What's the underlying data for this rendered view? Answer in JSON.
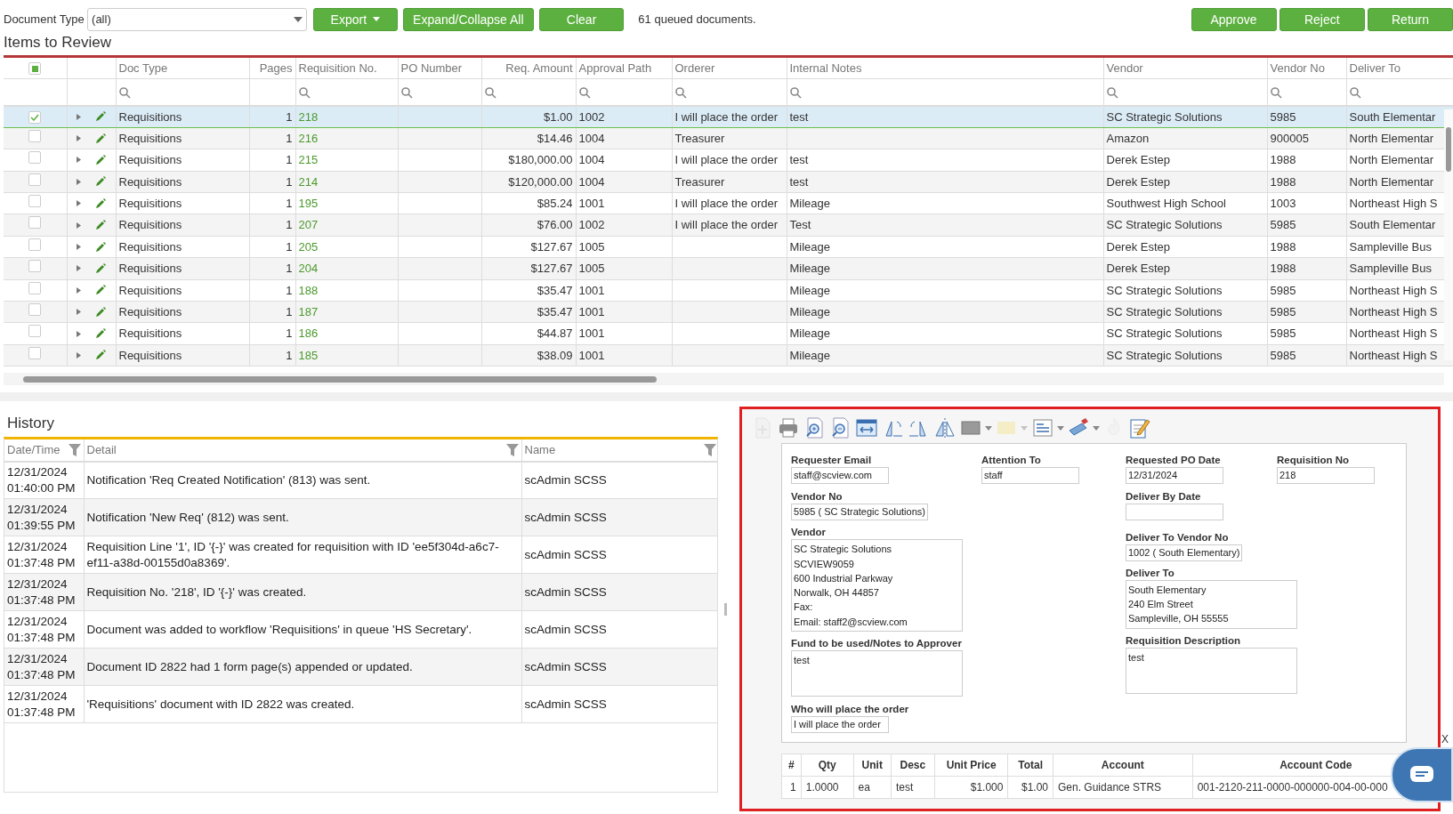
{
  "toolbar": {
    "document_type_label": "Document Type",
    "document_type_value": "(all)",
    "buttons": [
      {
        "label": "Export",
        "menu": true
      },
      {
        "label": "Expand/Collapse All",
        "menu": false
      },
      {
        "label": "Clear",
        "menu": false
      }
    ],
    "queue_count": "61 queued documents.",
    "action_buttons": [
      "Approve",
      "Reject",
      "Return"
    ]
  },
  "items_title": "Items to Review",
  "grid": {
    "select_all_indeterminate": true,
    "columns": [
      {
        "label": "Doc Type",
        "kind": "text",
        "filter": true
      },
      {
        "label": "Pages",
        "kind": "number",
        "filter": false
      },
      {
        "label": "Requisition No.",
        "kind": "link",
        "filter": true
      },
      {
        "label": "PO Number",
        "kind": "text",
        "filter": true
      },
      {
        "label": "Req. Amount",
        "kind": "number",
        "filter": true
      },
      {
        "label": "Approval Path",
        "kind": "text",
        "filter": true
      },
      {
        "label": "Orderer",
        "kind": "text",
        "filter": true
      },
      {
        "label": "Internal Notes",
        "kind": "text",
        "filter": true
      },
      {
        "label": "Vendor",
        "kind": "text",
        "filter": true
      },
      {
        "label": "Vendor No",
        "kind": "text",
        "filter": true
      },
      {
        "label": "Deliver To",
        "kind": "text",
        "filter": true
      }
    ],
    "rows": [
      {
        "selected": true,
        "doc_type": "Requisitions",
        "pages": "1",
        "requisition_no": "218",
        "req_amount": "$1.00",
        "approval_path": "1002",
        "orderer": "I will place the order",
        "internal_notes": "test",
        "vendor": "SC Strategic Solutions",
        "vendor_no": "5985",
        "deliver_to": "South Elementar"
      },
      {
        "selected": false,
        "doc_type": "Requisitions",
        "pages": "1",
        "requisition_no": "216",
        "req_amount": "$14.46",
        "approval_path": "1004",
        "orderer": "Treasurer",
        "vendor": "Amazon",
        "vendor_no": "900005",
        "deliver_to": "North Elementar"
      },
      {
        "selected": false,
        "doc_type": "Requisitions",
        "pages": "1",
        "requisition_no": "215",
        "req_amount": "$180,000.00",
        "approval_path": "1004",
        "orderer": "I will place the order",
        "internal_notes": "test",
        "vendor": "Derek Estep",
        "vendor_no": "1988",
        "deliver_to": "North Elementar"
      },
      {
        "selected": false,
        "doc_type": "Requisitions",
        "pages": "1",
        "requisition_no": "214",
        "req_amount": "$120,000.00",
        "approval_path": "1004",
        "orderer": "Treasurer",
        "internal_notes": "test",
        "vendor": "Derek Estep",
        "vendor_no": "1988",
        "deliver_to": "North Elementar"
      },
      {
        "selected": false,
        "doc_type": "Requisitions",
        "pages": "1",
        "requisition_no": "195",
        "req_amount": "$85.24",
        "approval_path": "1001",
        "orderer": "I will place the order",
        "internal_notes": "Mileage",
        "vendor": "Southwest High School",
        "vendor_no": "1003",
        "deliver_to": "Northeast High S"
      },
      {
        "selected": false,
        "doc_type": "Requisitions",
        "pages": "1",
        "requisition_no": "207",
        "req_amount": "$76.00",
        "approval_path": "1002",
        "orderer": "I will place the order",
        "internal_notes": "Test",
        "vendor": "SC Strategic Solutions",
        "vendor_no": "5985",
        "deliver_to": "South Elementar"
      },
      {
        "selected": false,
        "doc_type": "Requisitions",
        "pages": "1",
        "requisition_no": "205",
        "req_amount": "$127.67",
        "approval_path": "1005",
        "internal_notes": "Mileage",
        "vendor": "Derek Estep",
        "vendor_no": "1988",
        "deliver_to": "Sampleville Bus"
      },
      {
        "selected": false,
        "doc_type": "Requisitions",
        "pages": "1",
        "requisition_no": "204",
        "req_amount": "$127.67",
        "approval_path": "1005",
        "internal_notes": "Mileage",
        "vendor": "Derek Estep",
        "vendor_no": "1988",
        "deliver_to": "Sampleville Bus"
      },
      {
        "selected": false,
        "doc_type": "Requisitions",
        "pages": "1",
        "requisition_no": "188",
        "req_amount": "$35.47",
        "approval_path": "1001",
        "internal_notes": "Mileage",
        "vendor": "SC Strategic Solutions",
        "vendor_no": "5985",
        "deliver_to": "Northeast High S"
      },
      {
        "selected": false,
        "doc_type": "Requisitions",
        "pages": "1",
        "requisition_no": "187",
        "req_amount": "$35.47",
        "approval_path": "1001",
        "internal_notes": "Mileage",
        "vendor": "SC Strategic Solutions",
        "vendor_no": "5985",
        "deliver_to": "Northeast High S"
      },
      {
        "selected": false,
        "doc_type": "Requisitions",
        "pages": "1",
        "requisition_no": "186",
        "req_amount": "$44.87",
        "approval_path": "1001",
        "internal_notes": "Mileage",
        "vendor": "SC Strategic Solutions",
        "vendor_no": "5985",
        "deliver_to": "Northeast High S"
      },
      {
        "selected": false,
        "doc_type": "Requisitions",
        "pages": "1",
        "requisition_no": "185",
        "req_amount": "$38.09",
        "approval_path": "1001",
        "internal_notes": "Mileage",
        "vendor": "SC Strategic Solutions",
        "vendor_no": "5985",
        "deliver_to": "Northeast High S"
      }
    ]
  },
  "history": {
    "title": "History",
    "columns": [
      {
        "label": "Date/Time",
        "filter": true
      },
      {
        "label": "Detail",
        "filter": true
      },
      {
        "label": "Name",
        "filter": true
      }
    ],
    "rows": [
      {
        "date": "12/31/2024",
        "time": "01:40:00 PM",
        "detail": "Notification 'Req Created Notification' (813) was sent.",
        "name": "scAdmin SCSS"
      },
      {
        "date": "12/31/2024",
        "time": "01:39:55 PM",
        "detail": "Notification 'New Req' (812) was sent.",
        "name": "scAdmin SCSS"
      },
      {
        "date": "12/31/2024",
        "time": "01:37:48 PM",
        "detail": "Requisition Line '1', ID '{-}' was created for requisition with ID 'ee5f304d-a6c7-ef11-a38d-00155d0a8369'.",
        "name": "scAdmin SCSS"
      },
      {
        "date": "12/31/2024",
        "time": "01:37:48 PM",
        "detail": "Requisition No. '218', ID '{-}' was created.",
        "name": "scAdmin SCSS"
      },
      {
        "date": "12/31/2024",
        "time": "01:37:48 PM",
        "detail": "Document was added to workflow 'Requisitions' in queue 'HS Secretary'.",
        "name": "scAdmin SCSS"
      },
      {
        "date": "12/31/2024",
        "time": "01:37:48 PM",
        "detail": "Document ID 2822 had 1 form page(s) appended or updated.",
        "name": "scAdmin SCSS"
      },
      {
        "date": "12/31/2024",
        "time": "01:37:48 PM",
        "detail": "'Requisitions' document with ID 2822 was created.",
        "name": "scAdmin SCSS"
      }
    ]
  },
  "document": {
    "tools": [
      {
        "kind": "add-page",
        "disabled": true,
        "menu": false
      },
      {
        "kind": "print",
        "disabled": false,
        "menu": false
      },
      {
        "kind": "zoom-in",
        "disabled": false,
        "menu": false
      },
      {
        "kind": "zoom-out",
        "disabled": false,
        "menu": false
      },
      {
        "kind": "fit-width",
        "disabled": false,
        "menu": false
      },
      {
        "kind": "rotate-left",
        "disabled": false,
        "menu": false
      },
      {
        "kind": "rotate-right",
        "disabled": false,
        "menu": false
      },
      {
        "kind": "flip",
        "disabled": false,
        "menu": false
      },
      {
        "kind": "rectangle",
        "disabled": false,
        "menu": true
      },
      {
        "kind": "highlight",
        "disabled": true,
        "menu": true
      },
      {
        "kind": "text-box",
        "disabled": false,
        "menu": true
      },
      {
        "kind": "stamp",
        "disabled": false,
        "menu": true
      },
      {
        "kind": "flame",
        "disabled": true,
        "menu": false
      },
      {
        "kind": "note",
        "disabled": false,
        "menu": false
      }
    ],
    "top_fields": [
      {
        "label": "Requester Email",
        "kind": "input",
        "value": "staff@scview.com"
      },
      {
        "label": "Attention To",
        "kind": "input",
        "value": "staff"
      },
      {
        "label": "Requested PO Date",
        "kind": "input",
        "value": "12/31/2024"
      },
      {
        "label": "Requisition No",
        "kind": "input",
        "value": "218"
      }
    ],
    "left_fields": [
      {
        "label": "Vendor No",
        "kind": "input",
        "value": "5985 ( SC Strategic Solutions)"
      },
      {
        "label": "Vendor",
        "kind": "textarea",
        "lines": [
          "SC Strategic Solutions",
          "SCVIEW9059",
          "600 Industrial Parkway",
          "Norwalk, OH 44857",
          "Fax:",
          "Email: staff2@scview.com"
        ]
      },
      {
        "label": "Fund to be used/Notes to Approver",
        "kind": "textarea",
        "lines": [
          "test"
        ]
      },
      {
        "label": "Who will place the order",
        "kind": "input",
        "value": "I will place the order"
      }
    ],
    "right_fields": [
      {
        "label": "Deliver By Date",
        "kind": "input"
      },
      {
        "label": "Deliver To Vendor No",
        "kind": "input",
        "value": "1002 ( South Elementary)"
      },
      {
        "label": "Deliver To",
        "kind": "textarea",
        "lines": [
          "South Elementary",
          "240 Elm Street",
          "Sampleville, OH 55555"
        ]
      },
      {
        "label": "Requisition Description",
        "kind": "textarea",
        "lines": [
          "test"
        ]
      }
    ],
    "lines_columns": [
      "#",
      "Qty",
      "Unit",
      "Desc",
      "Unit Price",
      "Total",
      "Account",
      "Account Code"
    ],
    "lines_rows": [
      [
        "1",
        "1.0000",
        "ea",
        "test",
        "$1.000",
        "$1.00",
        "Gen. Guidance STRS",
        "001-2120-211-0000-000000-004-00-000"
      ]
    ]
  },
  "chat_close": "X"
}
